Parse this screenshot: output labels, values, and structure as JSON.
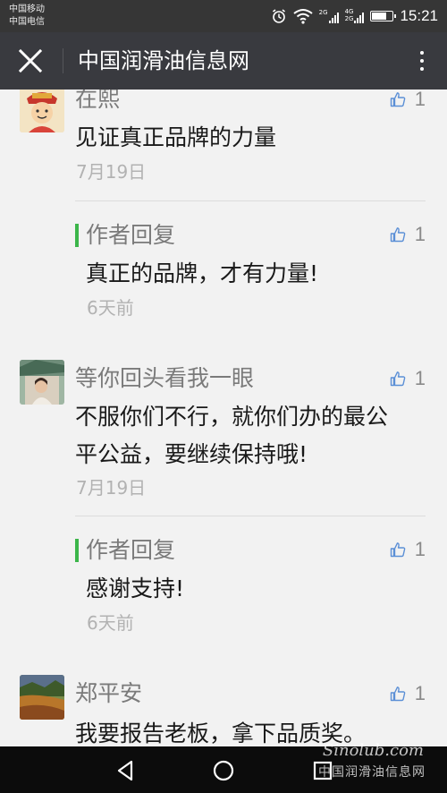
{
  "status_bar": {
    "carrier_1": "中国移动",
    "carrier_2": "中国电信",
    "net_1": "2G",
    "net_2a": "4G",
    "net_2b": "2G",
    "time": "15:21",
    "battery_level": 0.75
  },
  "header": {
    "title": "中国润滑油信息网"
  },
  "comments": [
    {
      "name": "在熙",
      "text": "见证真正品牌的力量",
      "date": "7月19日",
      "likes": "1",
      "reply": {
        "label": "作者回复",
        "text": "真正的品牌，才有力量!",
        "date": "6天前",
        "likes": "1"
      }
    },
    {
      "name": "等你回头看我一眼",
      "text_line1": "不服你们不行，就你们办的最公",
      "text_line2": "平公益，要继续保持哦!",
      "date": "7月19日",
      "likes": "1",
      "reply": {
        "label": "作者回复",
        "text": "感谢支持!",
        "date": "6天前",
        "likes": "1"
      }
    },
    {
      "name": "郑平安",
      "text": "我要报告老板，拿下品质奖。",
      "likes": "1"
    }
  ],
  "watermark": {
    "text": "中国润滑油信息网",
    "logo": "Sinolub.com"
  },
  "icons": {
    "close": "close-icon",
    "more": "more-vertical-icon",
    "like": "thumbs-up-icon",
    "back": "back-triangle-icon",
    "home": "home-circle-icon",
    "recents": "recents-square-icon"
  },
  "colors": {
    "header_bg": "#393a3f",
    "reply_accent": "#3cb64a",
    "like_icon": "#5b8fd6"
  }
}
